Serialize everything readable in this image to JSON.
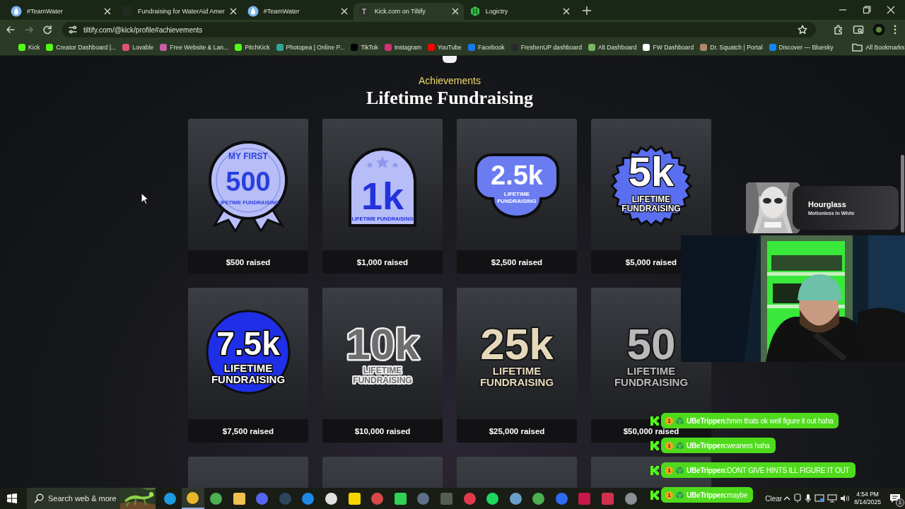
{
  "browser": {
    "tabs": [
      {
        "title": "#TeamWater",
        "kind": "water",
        "selected": false
      },
      {
        "title": "Fundraising for WaterAid Amer",
        "kind": "blank",
        "selected": false
      },
      {
        "title": "#TeamWater",
        "kind": "water",
        "selected": false
      },
      {
        "title": "Kick.com on Tiltify",
        "kind": "tiltify",
        "selected": true
      },
      {
        "title": "Logictry",
        "kind": "logictry",
        "selected": false
      }
    ],
    "url": "tiltify.com/@kick/profile#achievements",
    "bookmarks": [
      {
        "label": "Kick",
        "color": "#53fc18"
      },
      {
        "label": "Creator Dashboard |...",
        "color": "#53fc18"
      },
      {
        "label": "Lovable",
        "color": "#e0507a"
      },
      {
        "label": "Free Website & Lan...",
        "color": "#c85fa8"
      },
      {
        "label": "PitchKick",
        "color": "#53fc18"
      },
      {
        "label": "Photopea | Online P...",
        "color": "#2fa79a"
      },
      {
        "label": "TikTok",
        "color": "#000000"
      },
      {
        "label": "Instagram",
        "color": "#d62e7a"
      },
      {
        "label": "YouTube",
        "color": "#ff0000"
      },
      {
        "label": "Facebook",
        "color": "#1877f2"
      },
      {
        "label": "FreshenUP dashboard",
        "color": "#2a2a2a"
      },
      {
        "label": "Alt Dashboard",
        "color": "#7bb661"
      },
      {
        "label": "FW Dashboard",
        "color": "#ffffff"
      },
      {
        "label": "Dr. Squatch | Portal",
        "color": "#b08870"
      },
      {
        "label": "Discover — Bluesky",
        "color": "#1185fe"
      }
    ],
    "all_bookmarks": "All Bookmarks"
  },
  "page": {
    "eyebrow": "Achievements",
    "title": "Lifetime Fundraising",
    "achievements": [
      {
        "kind": "ribbon",
        "color": "#b7bdf7",
        "top": "MY FIRST",
        "number": "500",
        "caption": [
          "LIFETIME FUNDRAISING"
        ],
        "label": "$500 raised"
      },
      {
        "kind": "arch",
        "color": "#b7bdf7",
        "number": "1k",
        "caption": [
          "LIFETIME FUNDRAISING"
        ],
        "label": "$1,000 raised"
      },
      {
        "kind": "pill",
        "color": "#6b7cf0",
        "number": "2.5k",
        "caption": [
          "LIFETIME",
          "FUNDRAISING"
        ],
        "label": "$2,500 raised"
      },
      {
        "kind": "scallop",
        "color": "#5a6ff0",
        "number": "5k",
        "caption": [
          "LIFETIME",
          "FUNDRAISING"
        ],
        "label": "$5,000 raised"
      },
      {
        "kind": "circle",
        "color": "#1f2fe8",
        "number": "7.5k",
        "caption": [
          "LIFETIME",
          "FUNDRAISING"
        ],
        "label": "$7,500 raised"
      },
      {
        "kind": "outline",
        "color": "#6e6e6e",
        "number": "10k",
        "caption": [
          "LIFETIME",
          "FUNDRAISING"
        ],
        "label": "$10,000 raised"
      },
      {
        "kind": "text",
        "color": "#e6d9bb",
        "number": "25k",
        "caption": [
          "LIFETIME",
          "FUNDRAISING"
        ],
        "label": "$25,000 raised"
      },
      {
        "kind": "text",
        "color": "#b9b9b9",
        "number": "50",
        "caption": [
          "LIFETIME",
          "FUNDRAISING"
        ],
        "label": "$50,000 raised"
      },
      {
        "kind": "blank"
      },
      {
        "kind": "blank"
      },
      {
        "kind": "blank"
      },
      {
        "kind": "blank"
      }
    ]
  },
  "now_playing": {
    "title": "Hourglass",
    "artist": "Motionless In White"
  },
  "chat": [
    {
      "badge": "1",
      "message": "**UBeTrippen:**hmm thats ok well figure it out haha"
    },
    {
      "badge": "1",
      "message": "**UBeTrippen:**weaners haha"
    },
    {
      "badge": "1",
      "message": "**UBeTrippen:**DONT GIVE HINTS ILL FIGURE IT OUT"
    },
    {
      "badge": "1",
      "message": "**UBeTrippen:**maybe"
    }
  ],
  "taskbar": {
    "search_placeholder": "Search web & more",
    "apps": [
      {
        "kind": "round",
        "color": "#1e9be0",
        "selected": false
      },
      {
        "kind": "round",
        "color": "#e8b62a",
        "selected": true
      },
      {
        "kind": "round",
        "color": "#4caf50",
        "selected": false
      },
      {
        "kind": "square",
        "color": "#f2c14e",
        "selected": false
      },
      {
        "kind": "round",
        "color": "#5865f2",
        "selected": false
      },
      {
        "kind": "round",
        "color": "#2a475e",
        "selected": false
      },
      {
        "kind": "round",
        "color": "#1e88e5",
        "selected": false
      },
      {
        "kind": "round",
        "color": "#e0e0e0",
        "selected": false
      },
      {
        "kind": "square",
        "color": "#f7d600",
        "selected": false
      },
      {
        "kind": "round",
        "color": "#d84a4a",
        "selected": false
      },
      {
        "kind": "square",
        "color": "#30d158",
        "selected": false
      },
      {
        "kind": "round",
        "color": "#5d6f8a",
        "selected": false
      },
      {
        "kind": "square",
        "color": "#555e55",
        "selected": false
      },
      {
        "kind": "round",
        "color": "#e03a4e",
        "selected": false
      },
      {
        "kind": "round",
        "color": "#1ed760",
        "selected": false
      },
      {
        "kind": "round",
        "color": "#6aa0c8",
        "selected": false
      },
      {
        "kind": "round",
        "color": "#4caf50",
        "selected": false
      },
      {
        "kind": "round",
        "color": "#2f6cf3",
        "selected": false
      },
      {
        "kind": "square",
        "color": "#c8174d",
        "selected": false
      },
      {
        "kind": "square",
        "color": "#d32f4f",
        "selected": false
      },
      {
        "kind": "round",
        "color": "#8a8f95",
        "selected": false
      }
    ],
    "tray_label": "Clear",
    "time": "4:54 PM",
    "date": "8/14/2025",
    "notifications": "1"
  }
}
